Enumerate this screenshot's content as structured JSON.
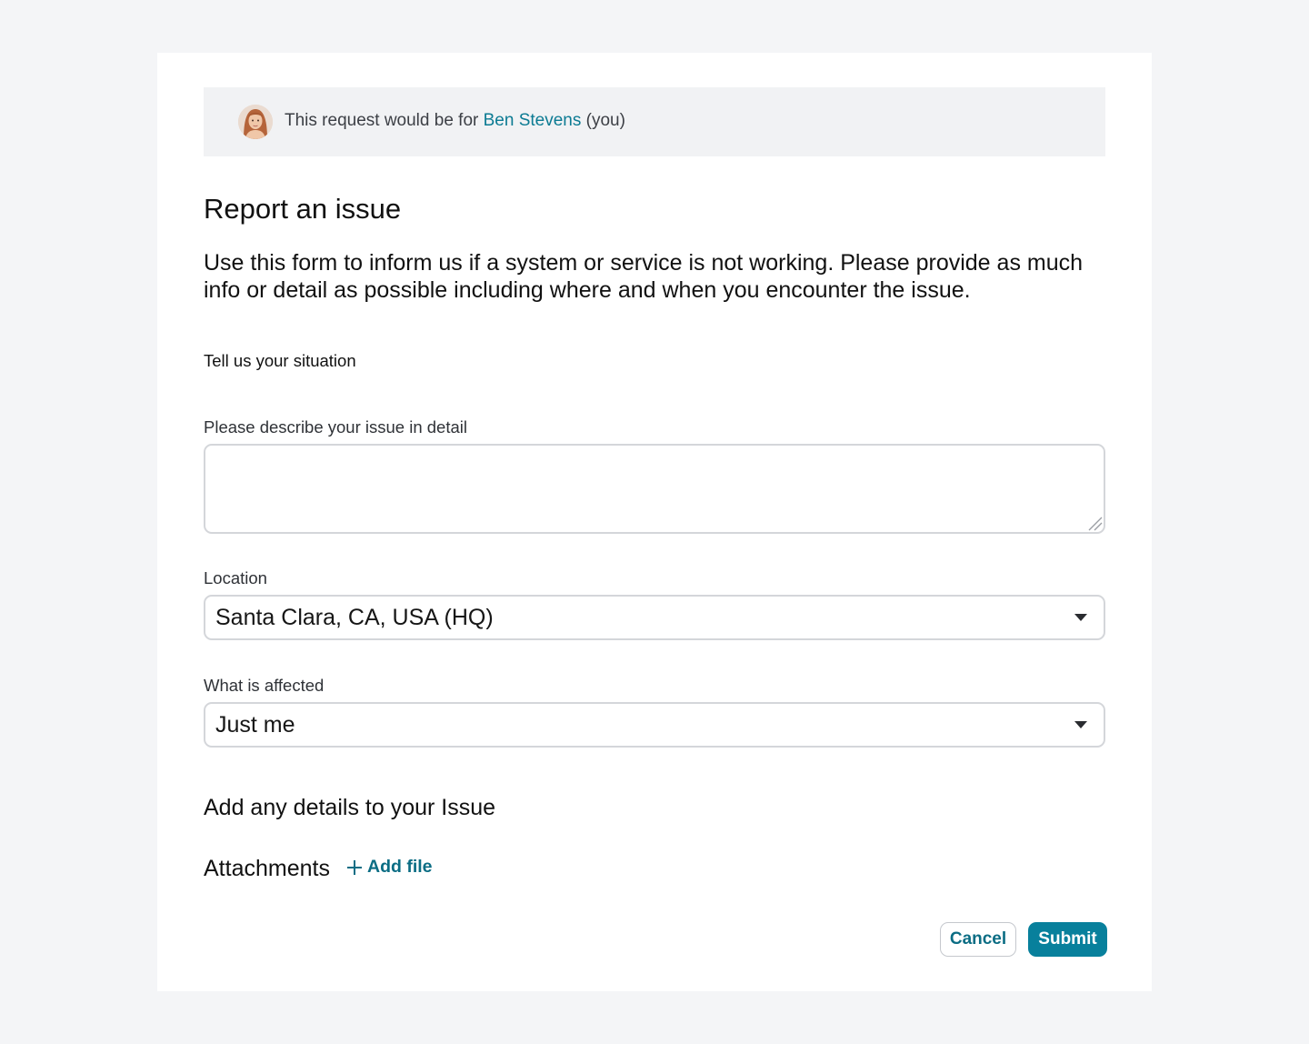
{
  "banner": {
    "prefix": "This request would be for ",
    "user_name": "Ben Stevens",
    "suffix": " (you)"
  },
  "form": {
    "title": "Report an issue",
    "description": "Use this form to inform us if a system or service is not working. Please provide as much info or detail as possible including where and when you encounter the issue.",
    "section_label": "Tell us your situation",
    "describe": {
      "label": "Please describe your issue in detail",
      "value": ""
    },
    "location": {
      "label": "Location",
      "value": "Santa Clara, CA, USA (HQ)"
    },
    "affected": {
      "label": "What is affected",
      "value": "Just me"
    },
    "details_heading": "Add any details to your Issue",
    "attachments": {
      "label": "Attachments",
      "add_file": "Add file"
    }
  },
  "actions": {
    "cancel": "Cancel",
    "submit": "Submit"
  },
  "colors": {
    "accent": "#08809c",
    "link": "#0c7b93",
    "page_bg": "#f4f5f7",
    "banner_bg": "#f1f2f4"
  }
}
